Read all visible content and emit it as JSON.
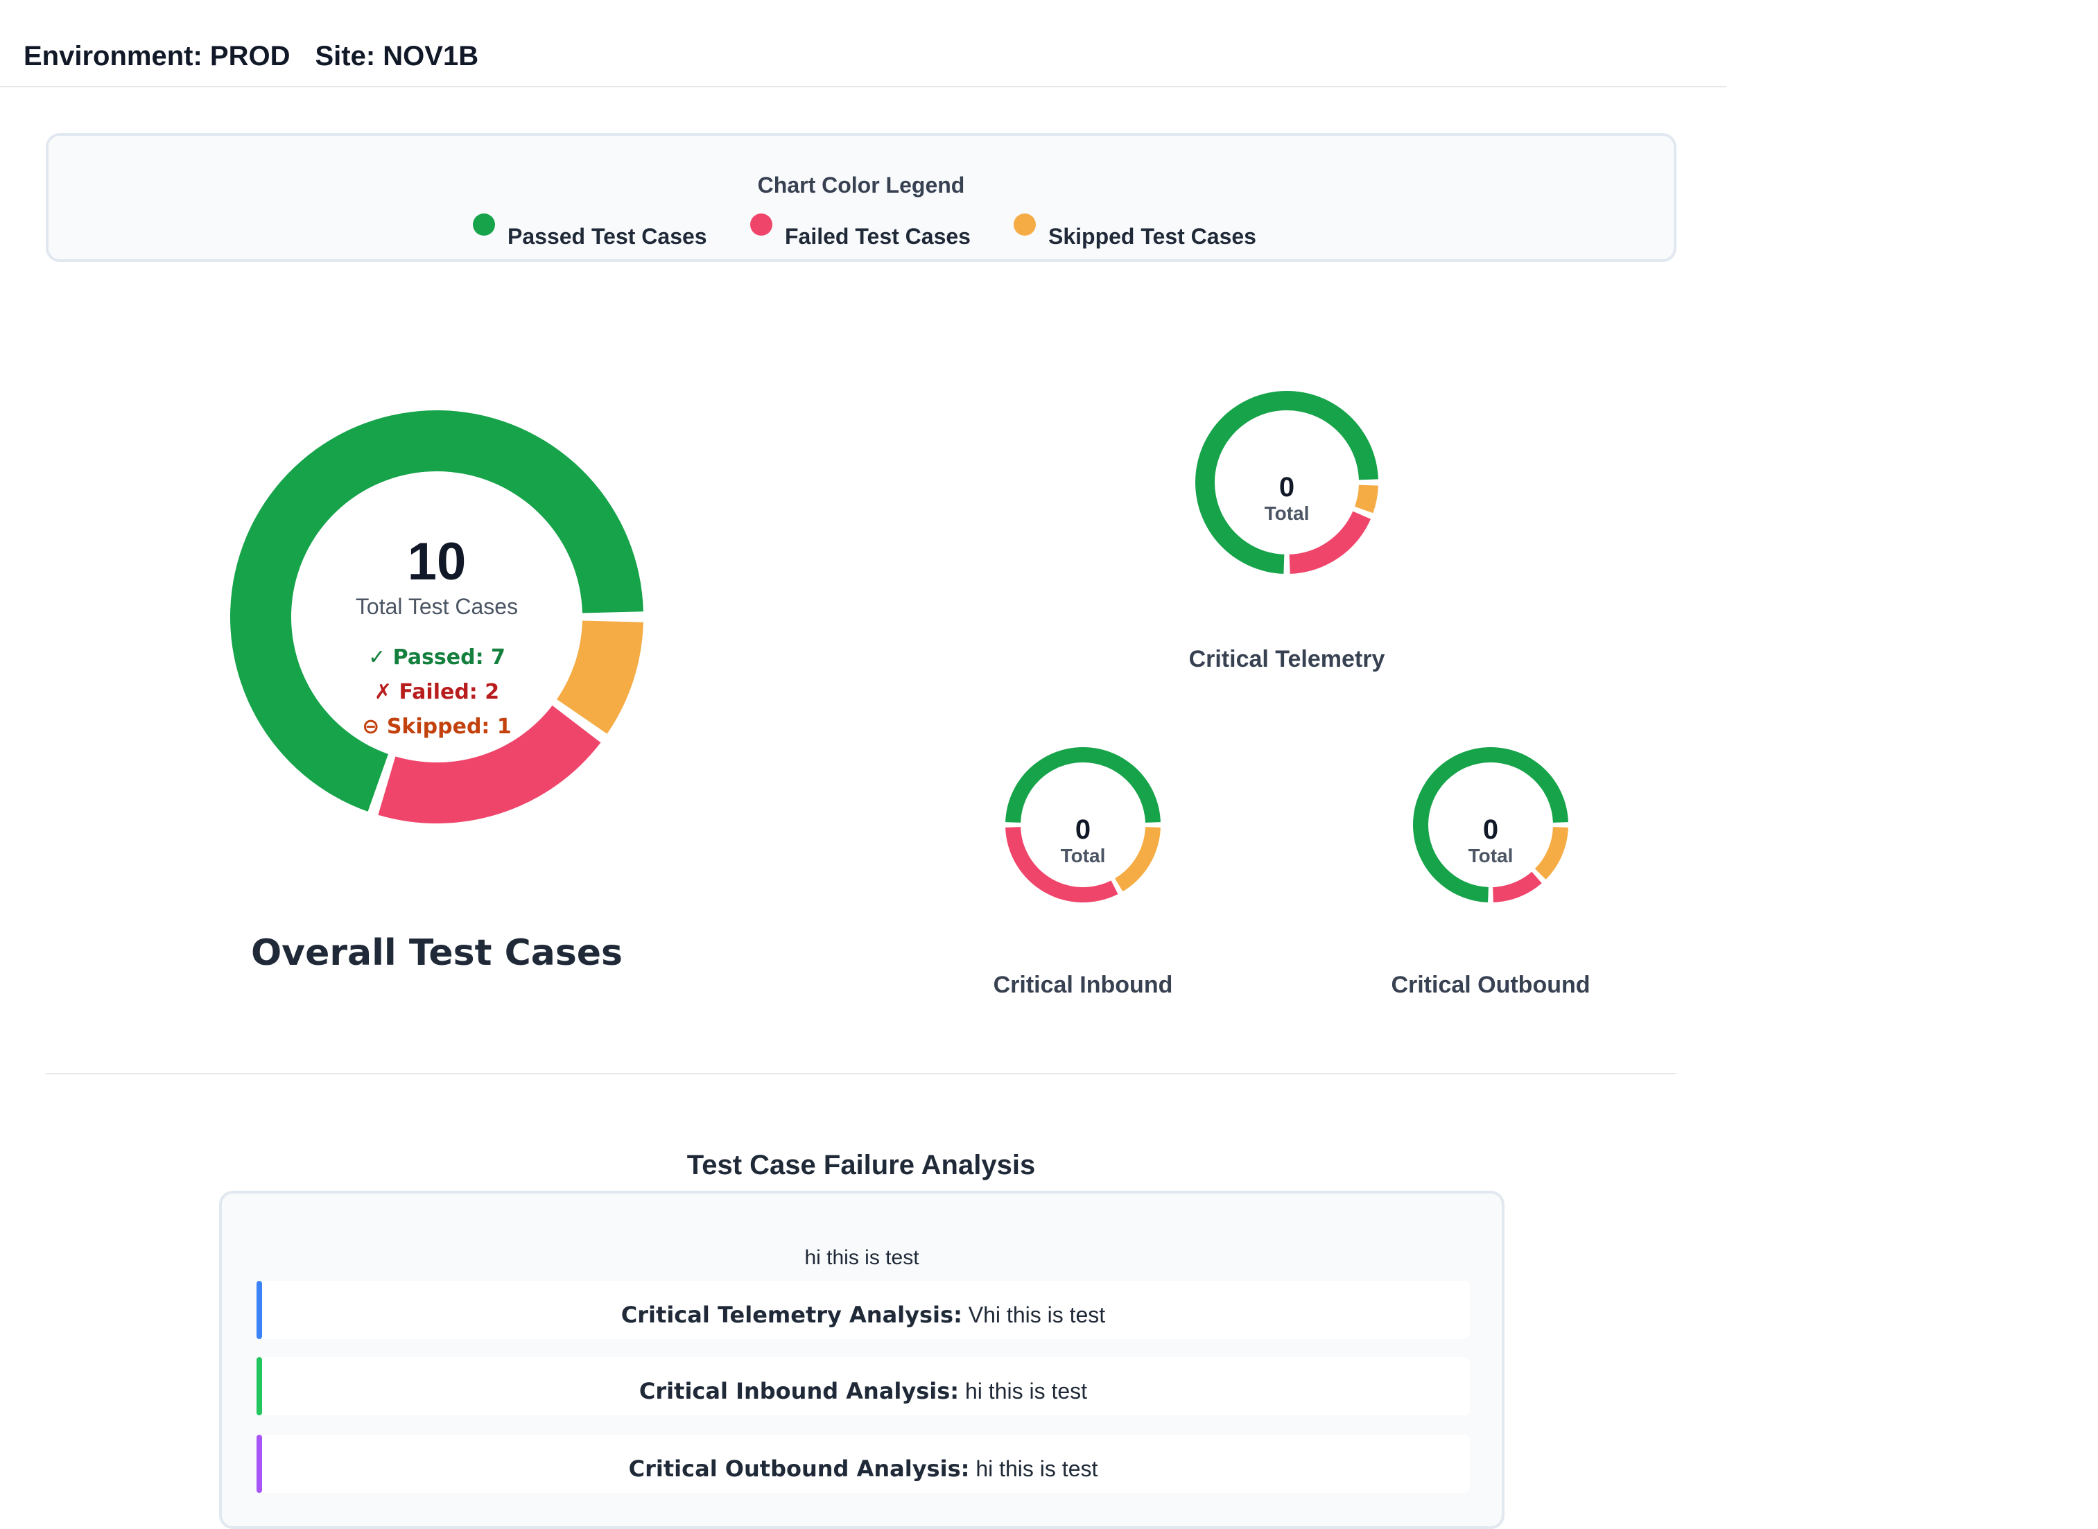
{
  "header": {
    "environment_text": "Environment: PROD",
    "site_text": "Site: NOV1B"
  },
  "legend": {
    "title": "Chart Color Legend",
    "items": [
      {
        "label": "Passed Test Cases",
        "color": "#16a34a"
      },
      {
        "label": "Failed Test Cases",
        "color": "#f0456a"
      },
      {
        "label": "Skipped Test Cases",
        "color": "#f5ac45"
      }
    ]
  },
  "overall": {
    "total": "10",
    "total_label": "Total Test Cases",
    "passed_text": "✓ Passed: 7",
    "failed_text": "✗ Failed: 2",
    "skipped_text": "⊖ Skipped: 1",
    "title": "Overall Test Cases"
  },
  "chart_data": [
    {
      "type": "pie",
      "title": "Overall Test Cases",
      "categories": [
        "Passed",
        "Failed",
        "Skipped"
      ],
      "values": [
        7,
        2,
        1
      ],
      "total": 10,
      "colors": [
        "#16a34a",
        "#f0456a",
        "#f5ac45"
      ]
    },
    {
      "type": "pie",
      "title": "Critical Telemetry",
      "categories": [
        "Passed",
        "Failed",
        "Skipped"
      ],
      "values": [
        0.75,
        0.19,
        0.06
      ],
      "total": 0,
      "colors": [
        "#16a34a",
        "#f0456a",
        "#f5ac45"
      ]
    },
    {
      "type": "pie",
      "title": "Critical Inbound",
      "categories": [
        "Passed",
        "Failed",
        "Skipped"
      ],
      "values": [
        0.5,
        0.33,
        0.17
      ],
      "total": 0,
      "colors": [
        "#16a34a",
        "#f0456a",
        "#f5ac45"
      ]
    },
    {
      "type": "pie",
      "title": "Critical Outbound",
      "categories": [
        "Passed",
        "Failed",
        "Skipped"
      ],
      "values": [
        0.75,
        0.12,
        0.13
      ],
      "total": 0,
      "colors": [
        "#16a34a",
        "#f0456a",
        "#f5ac45"
      ]
    }
  ],
  "small_charts": [
    {
      "center_value": "0",
      "center_label": "Total",
      "title": "Critical Telemetry"
    },
    {
      "center_value": "0",
      "center_label": "Total",
      "title": "Critical Inbound"
    },
    {
      "center_value": "0",
      "center_label": "Total",
      "title": "Critical Outbound"
    }
  ],
  "analysis": {
    "title": "Test Case Failure Analysis",
    "summary": "hi this is test",
    "rows": [
      {
        "label": "Critical Telemetry Analysis:",
        "value": "Vhi this is test",
        "color": "#3b82f6"
      },
      {
        "label": "Critical Inbound Analysis:",
        "value": "hi this is test",
        "color": "#22c55e"
      },
      {
        "label": "Critical Outbound Analysis:",
        "value": "hi this is test",
        "color": "#a855f7"
      }
    ]
  }
}
